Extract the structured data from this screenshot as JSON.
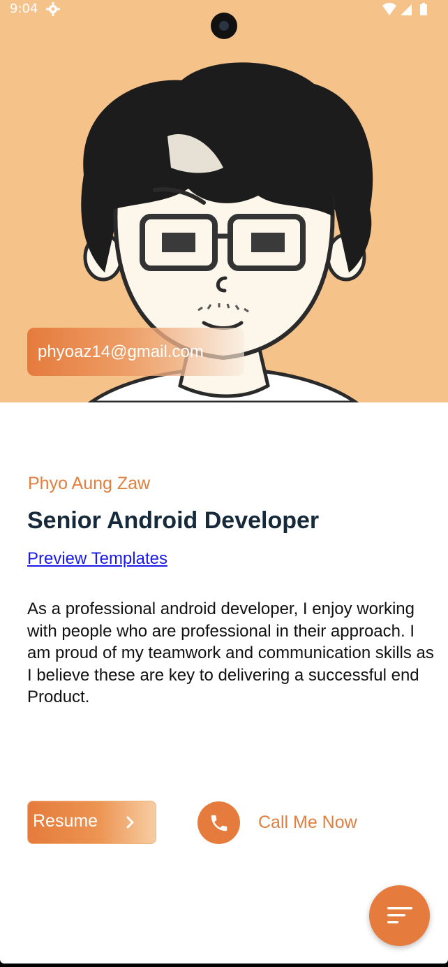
{
  "status_bar": {
    "time": "9:04",
    "icons": [
      "settings-icon",
      "wifi-icon",
      "signal-icon",
      "battery-icon"
    ]
  },
  "hero": {
    "email": "phyoaz14@gmail.com",
    "background_color": "#f5c28a"
  },
  "profile": {
    "name": "Phyo Aung Zaw",
    "title": "Senior Android Developer",
    "preview_link": "Preview Templates",
    "bio": "As a professional android developer, I enjoy working with people who are professional in their approach. I am proud of my teamwork and communication skills as I believe these are key to delivering a successful end Product."
  },
  "actions": {
    "resume_label": "Resume",
    "call_label": "Call Me Now",
    "fab_icon": "sort-icon"
  },
  "colors": {
    "accent": "#e57b3c",
    "title": "#15293a",
    "link": "#1a1ae6"
  }
}
